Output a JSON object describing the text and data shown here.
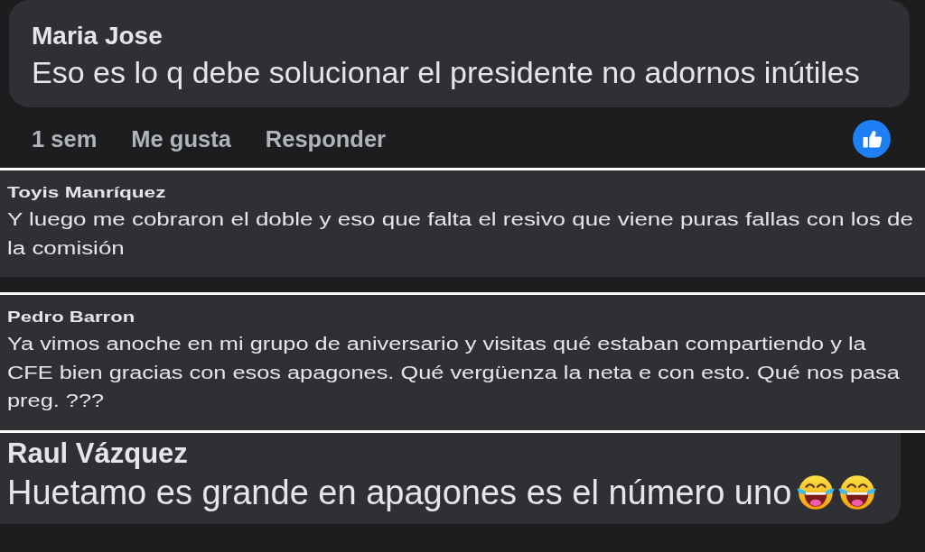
{
  "comments": [
    {
      "kind": "bubble",
      "author": "Maria Jose",
      "text": "Eso es lo q debe solucionar el presidente no adornos inútiles",
      "time": "1 sem",
      "actions": [
        "Me gusta",
        "Responder"
      ],
      "reactions": [
        {
          "kind": "like"
        }
      ]
    },
    {
      "kind": "strip",
      "author": "Toyis Manríquez",
      "text": "Y luego me cobraron el doble y eso que falta el resivo que viene puras fallas con los de la comisión"
    },
    {
      "kind": "strip",
      "author": "Pedro Barron",
      "text": "Ya vimos anoche en mi grupo de aniversario y visitas qué estaban compartiendo y la CFE bien gracias con esos apagones. Qué vergüenza la neta e con esto. Qué nos pasa preg. ???"
    },
    {
      "kind": "cropped",
      "author": "Raul Vázquez",
      "text": "Huetamo es grande en apagones es el número uno",
      "emojis": [
        {
          "kind": "tears-of-joy"
        },
        {
          "kind": "tears-of-joy"
        }
      ]
    }
  ]
}
